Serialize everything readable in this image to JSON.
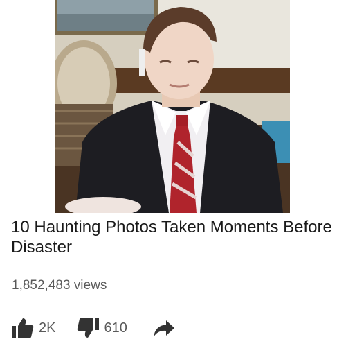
{
  "video": {
    "title": "10 Haunting Photos Taken Moments Before Disaster",
    "views_label": "1,852,483 views"
  },
  "actions": {
    "like_count": "2K",
    "dislike_count": "610"
  },
  "icons": {
    "like": "thumbs-up-icon",
    "dislike": "thumbs-down-icon",
    "share": "share-arrow-icon"
  },
  "colors": {
    "text_primary": "#1a1a1a",
    "text_secondary": "#5a5a5a",
    "icon": "#333333"
  }
}
